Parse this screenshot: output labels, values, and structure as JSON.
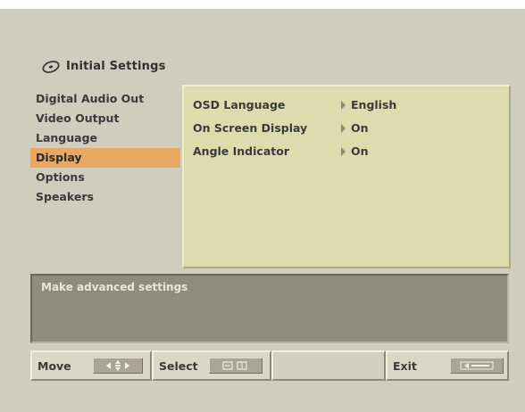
{
  "header": {
    "title": "Initial Settings",
    "icon": "disc-icon"
  },
  "menu": {
    "items": [
      {
        "label": "Digital Audio Out",
        "selected": false
      },
      {
        "label": "Video Output",
        "selected": false
      },
      {
        "label": "Language",
        "selected": false
      },
      {
        "label": "Display",
        "selected": true
      },
      {
        "label": "Options",
        "selected": false
      },
      {
        "label": "Speakers",
        "selected": false
      }
    ]
  },
  "settings": [
    {
      "name": "OSD Language",
      "value": "English"
    },
    {
      "name": "On Screen Display",
      "value": "On"
    },
    {
      "name": "Angle Indicator",
      "value": "On"
    }
  ],
  "description": "Make advanced settings",
  "bottom_bar": {
    "move_label": "Move",
    "select_label": "Select",
    "exit_label": "Exit",
    "move_key_icon": "arrow-keys-icon",
    "select_key_icon": "enter-key-icon",
    "exit_key_icon": "return-key-icon"
  },
  "colors": {
    "background": "#cfcdbd",
    "panel": "#dedcae",
    "selected_highlight": "#e6a862",
    "description_box": "#8d8c7e"
  }
}
